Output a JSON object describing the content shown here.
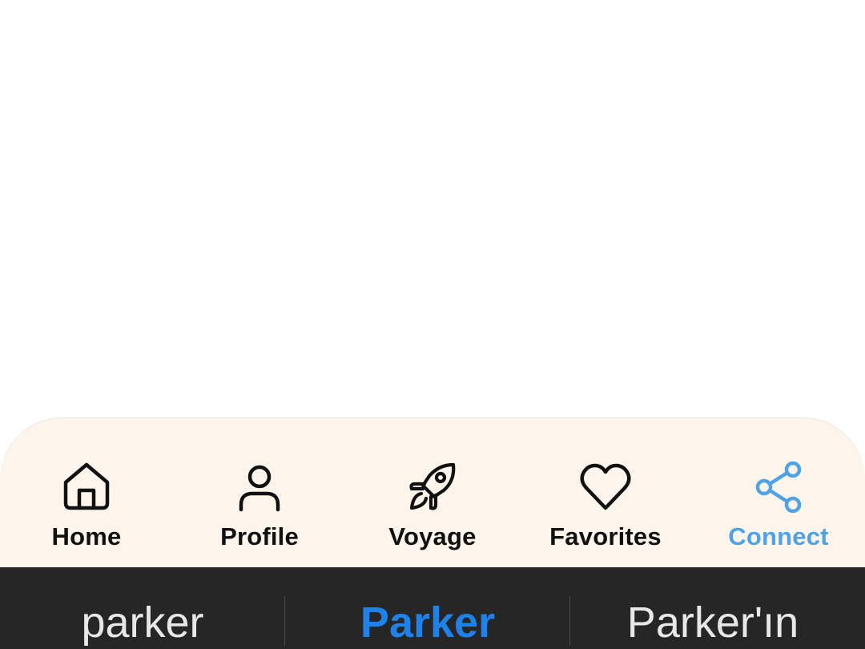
{
  "nav": {
    "items": [
      {
        "label": "Home",
        "icon": "home-icon",
        "active": false
      },
      {
        "label": "Profile",
        "icon": "person-icon",
        "active": false
      },
      {
        "label": "Voyage",
        "icon": "rocket-icon",
        "active": false
      },
      {
        "label": "Favorites",
        "icon": "heart-icon",
        "active": false
      },
      {
        "label": "Connect",
        "icon": "share-icon",
        "active": true
      }
    ],
    "active_color": "#4da3e6",
    "background": "#fdf5eb"
  },
  "keyboard": {
    "suggestions": [
      "parker",
      "Parker",
      "Parker'ın"
    ],
    "primary_index": 1,
    "primary_color": "#1f82ea",
    "background": "#262626"
  }
}
